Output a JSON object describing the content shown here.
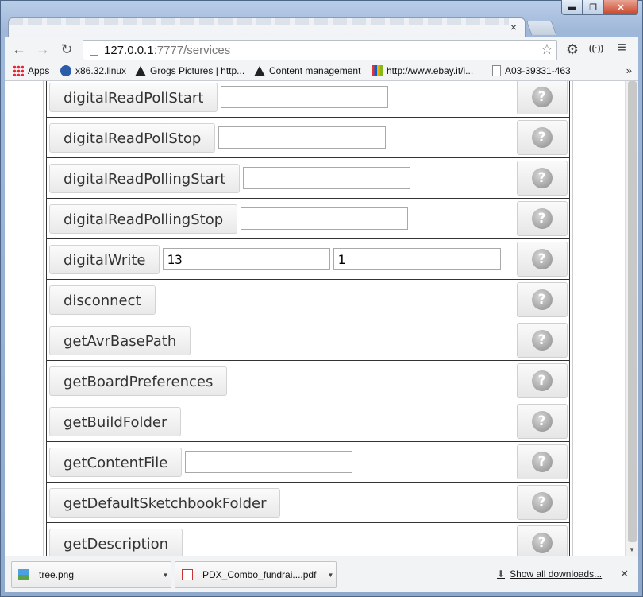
{
  "browser": {
    "address": {
      "host": "127.0.0.1",
      "rest": ":7777/services"
    },
    "tab_close": "×",
    "window_controls": {
      "minimize": "▬",
      "maximize": "❐",
      "close": "✕"
    },
    "nav": {
      "back": "←",
      "forward": "→",
      "reload": "↻"
    },
    "toolbar_icons": {
      "star": "☆",
      "settings": "⚙",
      "cast": "((·))",
      "menu": "≡"
    }
  },
  "bookmarks": [
    {
      "label": "Apps",
      "icon": "apps-grid-icon"
    },
    {
      "label": "x86.32.linux",
      "icon": "bookmark-icon"
    },
    {
      "label": "Grogs Pictures | http...",
      "icon": "bookmark-icon"
    },
    {
      "label": "Content management",
      "icon": "bookmark-icon"
    },
    {
      "label": "http://www.ebay.it/i...",
      "icon": "bookmark-icon"
    },
    {
      "label": "A03-39331-463",
      "icon": "page-icon"
    }
  ],
  "bookmarks_more": "»",
  "services": [
    {
      "name": "digitalReadPollStart",
      "args": [
        ""
      ]
    },
    {
      "name": "digitalReadPollStop",
      "args": [
        ""
      ]
    },
    {
      "name": "digitalReadPollingStart",
      "args": [
        ""
      ]
    },
    {
      "name": "digitalReadPollingStop",
      "args": [
        ""
      ]
    },
    {
      "name": "digitalWrite",
      "args": [
        "13",
        "1"
      ]
    },
    {
      "name": "disconnect",
      "args": []
    },
    {
      "name": "getAvrBasePath",
      "args": []
    },
    {
      "name": "getBoardPreferences",
      "args": []
    },
    {
      "name": "getBuildFolder",
      "args": []
    },
    {
      "name": "getContentFile",
      "args": [
        ""
      ]
    },
    {
      "name": "getDefaultSketchbookFolder",
      "args": []
    },
    {
      "name": "getDescription",
      "args": []
    }
  ],
  "help_glyph": "?",
  "downloads": {
    "items": [
      {
        "name": "tree.png"
      },
      {
        "name": "PDX_Combo_fundrai....pdf"
      }
    ],
    "show_all": "Show all downloads...",
    "close": "✕"
  }
}
